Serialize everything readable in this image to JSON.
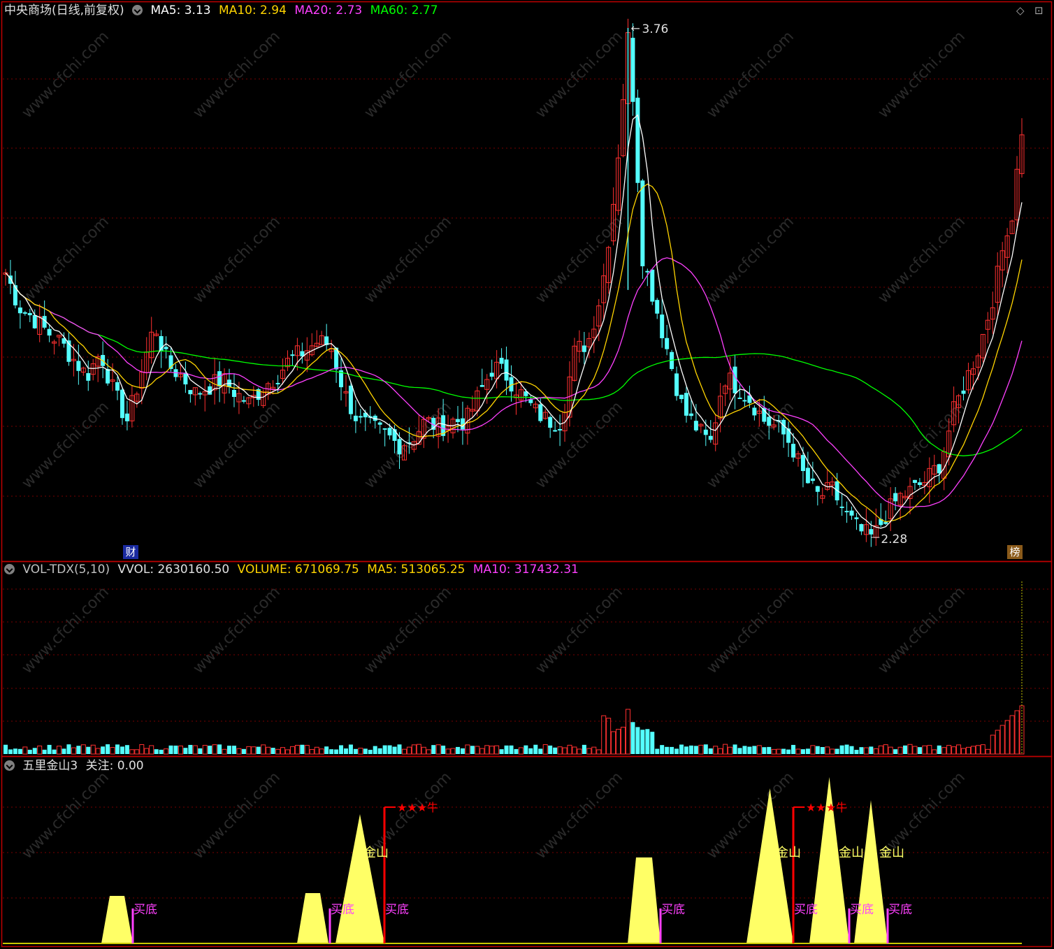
{
  "main": {
    "title": "中央商场(日线,前复权)",
    "ma_labels": [
      {
        "text": "MA5: 3.13",
        "color": "#ffffff"
      },
      {
        "text": "MA10: 2.94",
        "color": "#ffd400"
      },
      {
        "text": "MA20: 2.73",
        "color": "#ff40ff"
      },
      {
        "text": "MA60: 2.77",
        "color": "#00ff00"
      }
    ],
    "high_label": "3.76",
    "low_label": "2.28",
    "badge_cai": "财",
    "badge_bang": "榜",
    "window_icons": [
      "◇",
      "⊡"
    ]
  },
  "volume": {
    "title": "VOL-TDX(5,10)",
    "vvol": "VVOL: 2630160.50",
    "volume": "VOLUME: 671069.75",
    "ma5": "MA5: 513065.25",
    "ma10": "MA10: 317432.31"
  },
  "indicator": {
    "title": "五里金山3",
    "focus": "关注: 0.00",
    "buy_label": "买底",
    "gold_label": "金山",
    "bull_label": "★★★牛"
  },
  "colors": {
    "up": "#ff3030",
    "down": "#54ffff",
    "ma5": "#ffffff",
    "ma10": "#ffd400",
    "ma20": "#ff40ff",
    "ma60": "#00ff00",
    "grid": "#7a0000",
    "mountain": "#ffff66",
    "magenta": "#ff40ff",
    "red_signal": "#ff0000"
  },
  "watermark": "www.cfchi.com",
  "price_points": [
    3.05,
    2.95,
    2.92,
    2.88,
    2.85,
    2.8,
    2.75,
    2.82,
    2.7,
    2.62,
    2.76,
    2.9,
    2.78,
    2.75,
    2.7,
    2.72,
    2.74,
    2.7,
    2.67,
    2.72,
    2.75,
    2.8,
    2.82,
    2.85,
    2.84,
    2.7,
    2.62,
    2.6,
    2.58,
    2.55,
    2.57,
    2.62,
    2.6,
    2.62,
    2.62,
    2.7,
    2.78,
    2.75,
    2.7,
    2.65,
    2.62,
    2.62,
    2.82,
    2.85,
    3.0,
    3.3,
    3.76,
    3.1,
    2.95,
    2.8,
    2.65,
    2.6,
    2.55,
    2.75,
    2.72,
    2.68,
    2.62,
    2.6,
    2.55,
    2.45,
    2.4,
    2.42,
    2.35,
    2.3,
    2.28,
    2.35,
    2.4,
    2.42,
    2.45,
    2.5,
    2.65,
    2.75,
    2.85,
    3.0,
    3.2,
    3.45
  ]
}
